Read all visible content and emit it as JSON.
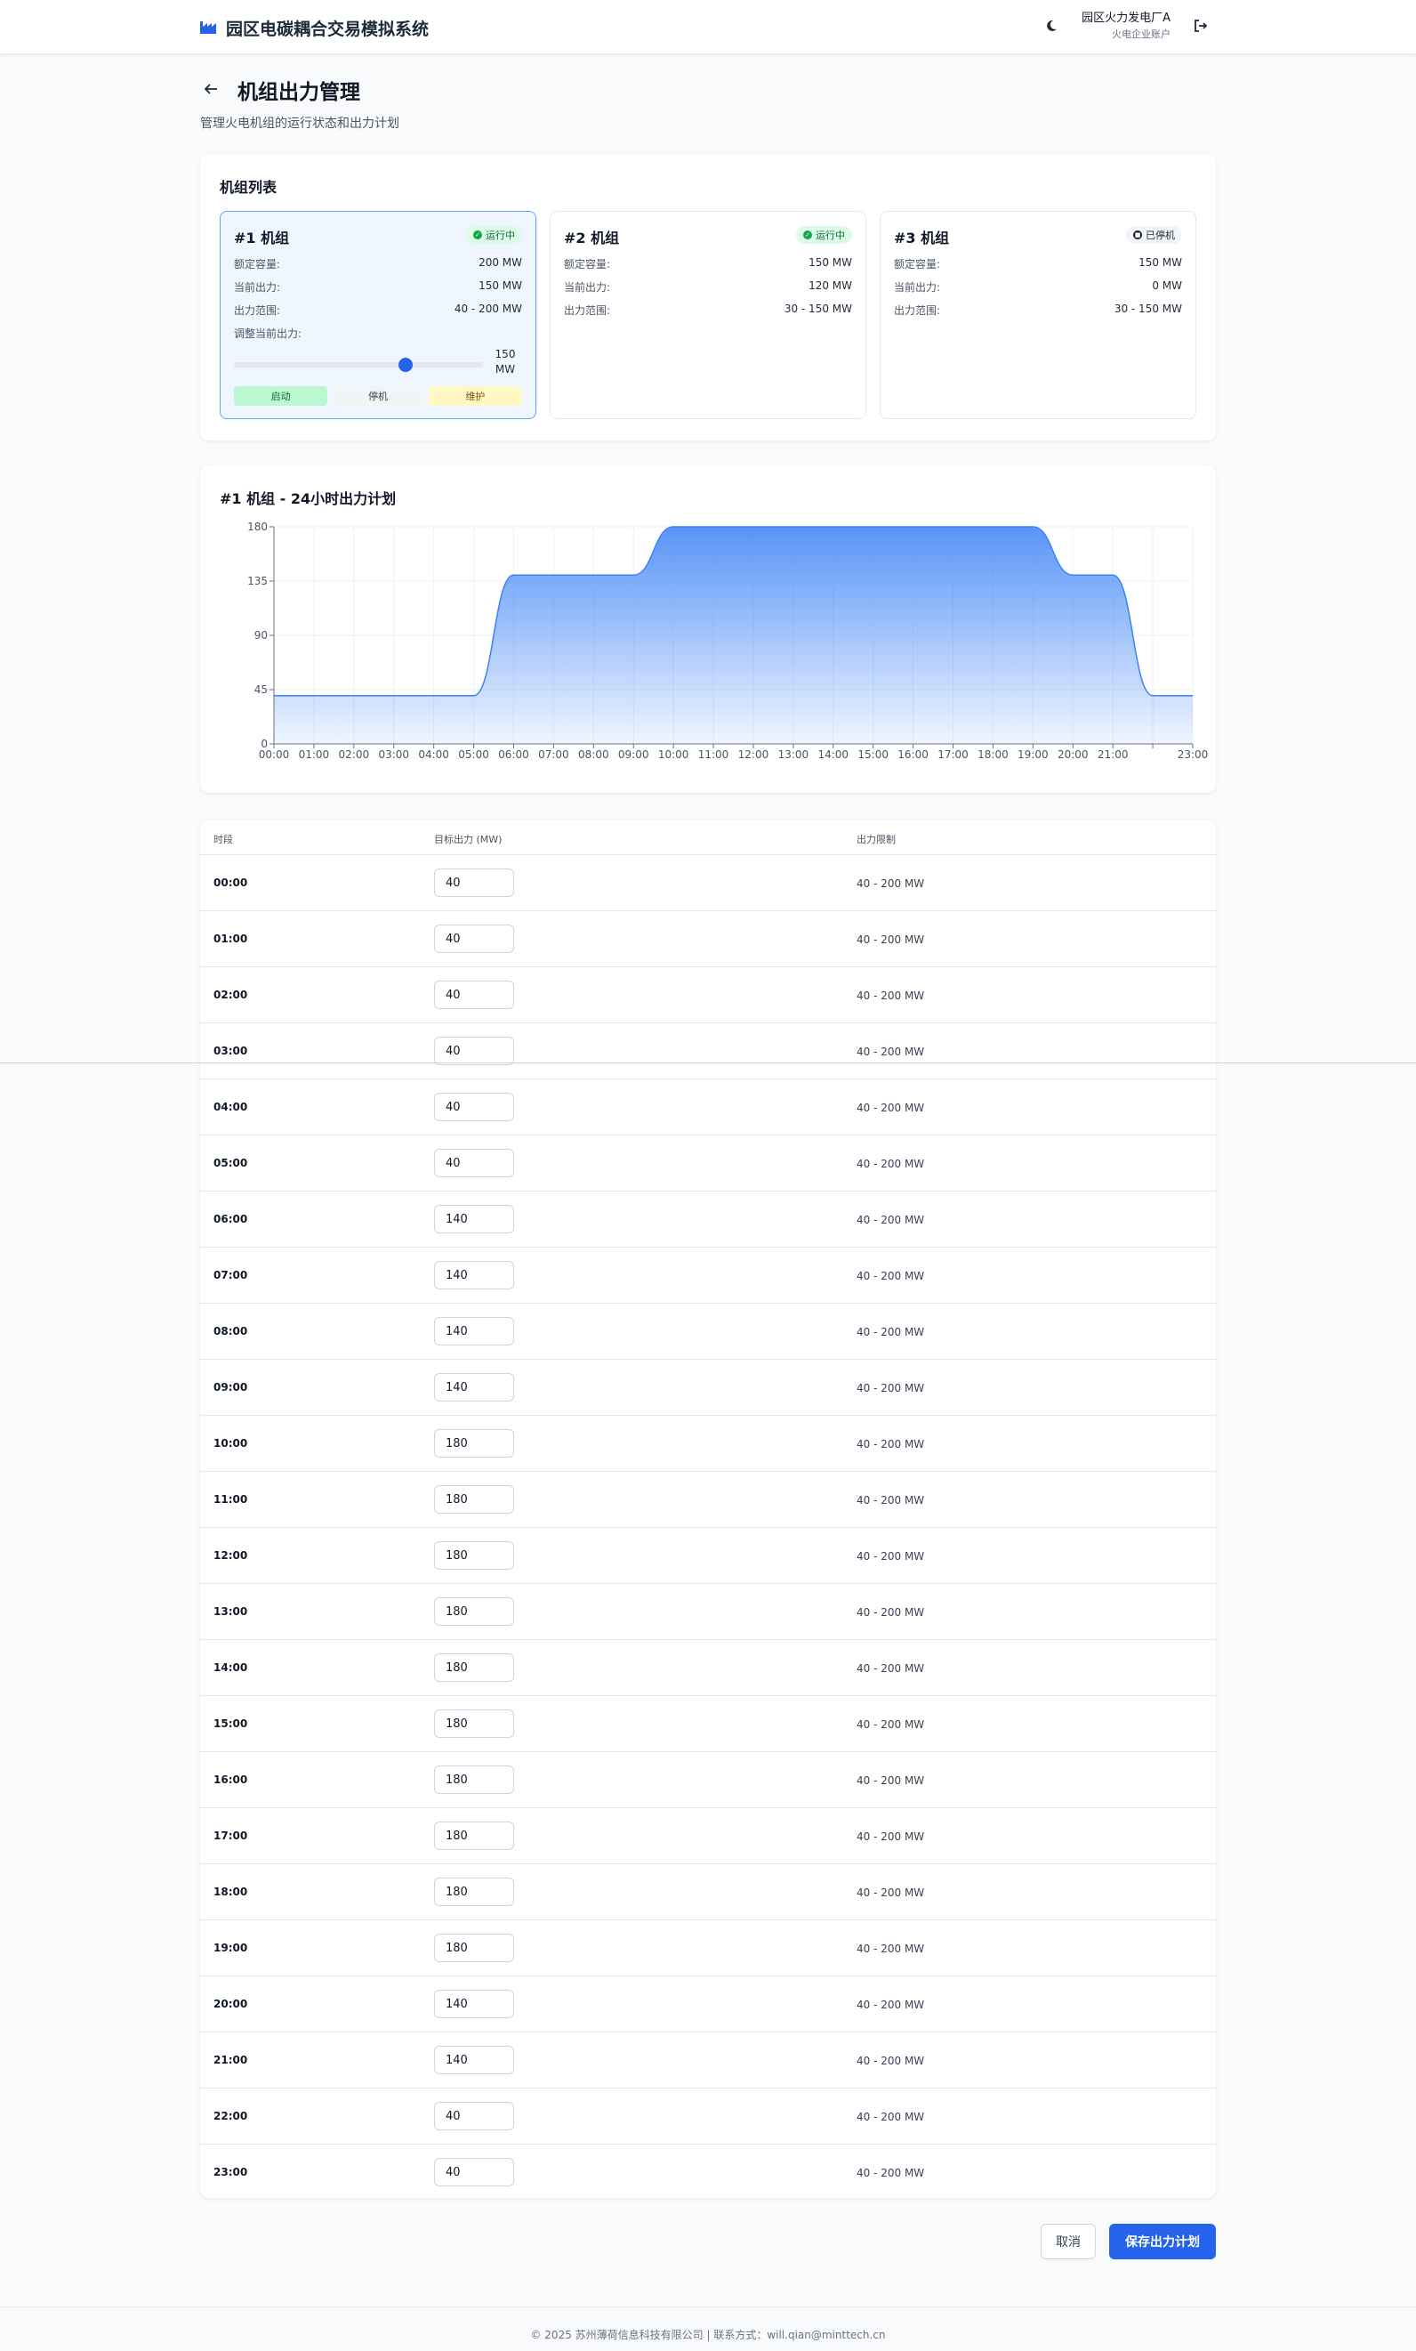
{
  "header": {
    "app_title": "园区电碳耦合交易模拟系统",
    "brand_color": "#2563eb",
    "user_name": "园区火力发电厂A",
    "user_role": "火电企业账户",
    "theme_icon": "moon-icon",
    "logout_icon": "logout-icon"
  },
  "page": {
    "title": "机组出力管理",
    "subtitle": "管理火电机组的运行状态和出力计划",
    "back_icon": "arrow-left-icon"
  },
  "units_section": {
    "title": "机组列表",
    "units": [
      {
        "name": "#1 机组",
        "status": "运行中",
        "status_type": "running",
        "rated_label": "额定容量:",
        "rated_value": "200 MW",
        "current_label": "当前出力:",
        "current_value": "150 MW",
        "range_label": "出力范围:",
        "range_value": "40 - 200 MW"
      },
      {
        "name": "#2 机组",
        "status": "运行中",
        "status_type": "running",
        "rated_label": "额定容量:",
        "rated_value": "150 MW",
        "current_label": "当前出力:",
        "current_value": "120 MW",
        "range_label": "出力范围:",
        "range_value": "30 - 150 MW"
      },
      {
        "name": "#3 机组",
        "status": "已停机",
        "status_type": "stopped",
        "rated_label": "额定容量:",
        "rated_value": "150 MW",
        "current_label": "当前出力:",
        "current_value": "0 MW",
        "range_label": "出力范围:",
        "range_value": "30 - 150 MW"
      }
    ],
    "selected": {
      "adjust_label": "调整当前出力:",
      "slider_min": 40,
      "slider_max": 200,
      "slider_value": 150,
      "slider_value_text": "150",
      "slider_unit": "MW",
      "btn_start": "启动",
      "btn_stop": "停机",
      "btn_maintain": "维护"
    }
  },
  "chart_section": {
    "title": "#1 机组 - 24小时出力计划"
  },
  "chart_data": {
    "type": "area",
    "title": "#1 机组 - 24小时出力计划",
    "x": [
      "00:00",
      "01:00",
      "02:00",
      "03:00",
      "04:00",
      "05:00",
      "06:00",
      "07:00",
      "08:00",
      "09:00",
      "10:00",
      "11:00",
      "12:00",
      "13:00",
      "14:00",
      "15:00",
      "16:00",
      "17:00",
      "18:00",
      "19:00",
      "20:00",
      "21:00",
      "22:00",
      "23:00"
    ],
    "x_tick_labels": [
      "00:00",
      "01:00",
      "02:00",
      "03:00",
      "04:00",
      "05:00",
      "06:00",
      "07:00",
      "08:00",
      "09:00",
      "10:00",
      "11:00",
      "12:00",
      "13:00",
      "14:00",
      "15:00",
      "16:00",
      "17:00",
      "18:00",
      "19:00",
      "20:00",
      "21:00",
      "",
      "23:00"
    ],
    "values": [
      40,
      40,
      40,
      40,
      40,
      40,
      140,
      140,
      140,
      140,
      180,
      180,
      180,
      180,
      180,
      180,
      180,
      180,
      180,
      180,
      140,
      140,
      40,
      40
    ],
    "y_ticks": [
      0,
      45,
      90,
      135,
      180
    ],
    "ylim": [
      0,
      180
    ],
    "grid": true,
    "color": "#3b82f6"
  },
  "schedule_table": {
    "col_time": "时段",
    "col_target": "目标出力 (MW)",
    "col_limit": "出力限制",
    "rows": [
      {
        "time": "00:00",
        "target": "40",
        "limit": "40 - 200 MW"
      },
      {
        "time": "01:00",
        "target": "40",
        "limit": "40 - 200 MW"
      },
      {
        "time": "02:00",
        "target": "40",
        "limit": "40 - 200 MW"
      },
      {
        "time": "03:00",
        "target": "40",
        "limit": "40 - 200 MW"
      },
      {
        "time": "04:00",
        "target": "40",
        "limit": "40 - 200 MW"
      },
      {
        "time": "05:00",
        "target": "40",
        "limit": "40 - 200 MW"
      },
      {
        "time": "06:00",
        "target": "140",
        "limit": "40 - 200 MW"
      },
      {
        "time": "07:00",
        "target": "140",
        "limit": "40 - 200 MW"
      },
      {
        "time": "08:00",
        "target": "140",
        "limit": "40 - 200 MW"
      },
      {
        "time": "09:00",
        "target": "140",
        "limit": "40 - 200 MW"
      },
      {
        "time": "10:00",
        "target": "180",
        "limit": "40 - 200 MW"
      },
      {
        "time": "11:00",
        "target": "180",
        "limit": "40 - 200 MW"
      },
      {
        "time": "12:00",
        "target": "180",
        "limit": "40 - 200 MW"
      },
      {
        "time": "13:00",
        "target": "180",
        "limit": "40 - 200 MW"
      },
      {
        "time": "14:00",
        "target": "180",
        "limit": "40 - 200 MW"
      },
      {
        "time": "15:00",
        "target": "180",
        "limit": "40 - 200 MW"
      },
      {
        "time": "16:00",
        "target": "180",
        "limit": "40 - 200 MW"
      },
      {
        "time": "17:00",
        "target": "180",
        "limit": "40 - 200 MW"
      },
      {
        "time": "18:00",
        "target": "180",
        "limit": "40 - 200 MW"
      },
      {
        "time": "19:00",
        "target": "180",
        "limit": "40 - 200 MW"
      },
      {
        "time": "20:00",
        "target": "140",
        "limit": "40 - 200 MW"
      },
      {
        "time": "21:00",
        "target": "140",
        "limit": "40 - 200 MW"
      },
      {
        "time": "22:00",
        "target": "40",
        "limit": "40 - 200 MW"
      },
      {
        "time": "23:00",
        "target": "40",
        "limit": "40 - 200 MW"
      }
    ]
  },
  "actions": {
    "cancel_label": "取消",
    "save_label": "保存出力计划"
  },
  "footer": {
    "text": "© 2025 苏州薄荷信息科技有限公司 | 联系方式：will.qian@minttech.cn"
  }
}
